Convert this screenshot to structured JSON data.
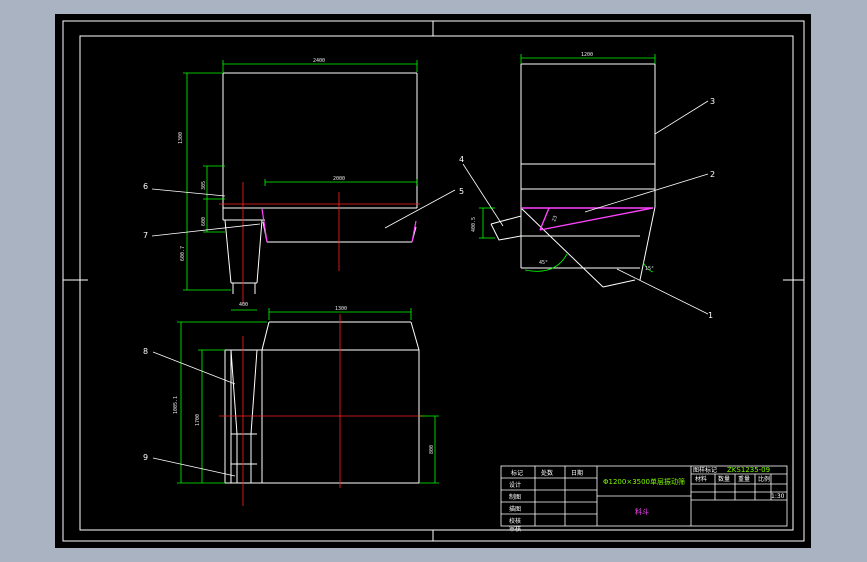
{
  "colors": {
    "background_outer": "#a9b3c2",
    "paper": "#000000",
    "outline": "#ffffff",
    "dimension": "#00ff00",
    "centerline": "#ff2020",
    "highlight": "#ff44ff"
  },
  "front_view": {
    "dims": {
      "width_top": "2400",
      "width_mid": "2000",
      "height_total": "1300",
      "h1": "305",
      "h2": "600",
      "h3": "600.7",
      "bottom_width": "400"
    }
  },
  "side_view": {
    "dims": {
      "width_top": "1200",
      "offset": "400.5",
      "angle_a": "23",
      "angle_b": "45°",
      "angle_c": "15°"
    }
  },
  "plan_view": {
    "dims": {
      "width": "1300",
      "height_total": "1005.1",
      "height_inner": "1700",
      "height_right": "800"
    }
  },
  "callouts": [
    "1",
    "2",
    "3",
    "4",
    "5",
    "6",
    "7",
    "8",
    "9"
  ],
  "title_block": {
    "headers": [
      "标记",
      "处数",
      "日期"
    ],
    "rows": [
      "设计",
      "制图",
      "描图",
      "校核",
      "审核"
    ],
    "product_title": "Φ1200×3500单层振动筛",
    "part_name": "料斗",
    "drawing_no": "ZKS1235-09",
    "materials_label": "图样标记",
    "sub_headers": [
      "材料",
      "数量",
      "重量",
      "比例"
    ],
    "scale": "1:30"
  }
}
